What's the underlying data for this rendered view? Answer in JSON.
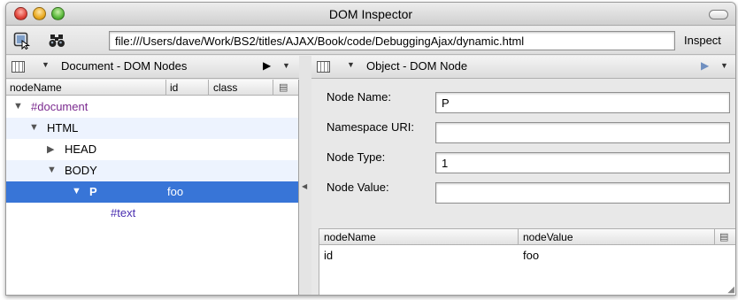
{
  "window": {
    "title": "DOM Inspector"
  },
  "toolbar": {
    "url": "file:///Users/dave/Work/BS2/titles/AJAX/Book/code/DebuggingAjax/dynamic.html",
    "inspect_label": "Inspect",
    "select_icon": "select-element-icon",
    "find_icon": "binoculars-icon"
  },
  "left_panel": {
    "title": "Document - DOM Nodes",
    "columns": [
      "nodeName",
      "id",
      "class"
    ],
    "rows": [
      {
        "name": "#document",
        "id": "",
        "expanded": true,
        "selected": false
      },
      {
        "name": "HTML",
        "id": "",
        "expanded": true,
        "selected": false
      },
      {
        "name": "HEAD",
        "id": "",
        "expanded": false,
        "selected": false
      },
      {
        "name": "BODY",
        "id": "",
        "expanded": true,
        "selected": false
      },
      {
        "name": "P",
        "id": "foo",
        "expanded": true,
        "selected": true
      },
      {
        "name": "#text",
        "id": "",
        "expanded": false,
        "selected": false
      }
    ]
  },
  "right_panel": {
    "title": "Object - DOM Node",
    "fields": [
      {
        "label": "Node Name:",
        "value": "P"
      },
      {
        "label": "Namespace URI:",
        "value": ""
      },
      {
        "label": "Node Type:",
        "value": "1"
      },
      {
        "label": "Node Value:",
        "value": ""
      }
    ],
    "attr_columns": [
      "nodeName",
      "nodeValue"
    ],
    "attributes": [
      {
        "name": "id",
        "value": "foo"
      }
    ]
  },
  "colors": {
    "selection": "#3875d7",
    "document_node": "#7b2a8f",
    "text_node": "#4a2eb0",
    "alt_row": "#edf3fe"
  }
}
